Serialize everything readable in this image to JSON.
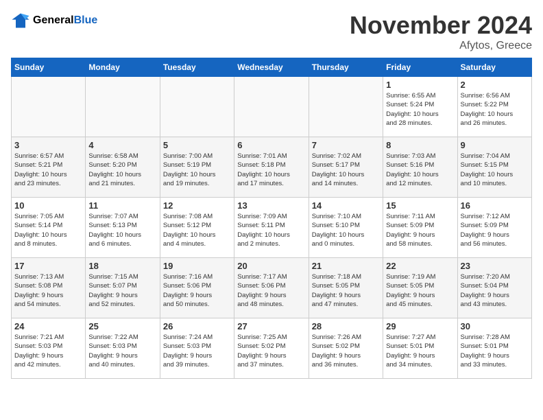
{
  "header": {
    "logo_line1": "General",
    "logo_line2": "Blue",
    "month": "November 2024",
    "location": "Afytos, Greece"
  },
  "weekdays": [
    "Sunday",
    "Monday",
    "Tuesday",
    "Wednesday",
    "Thursday",
    "Friday",
    "Saturday"
  ],
  "weeks": [
    [
      {
        "day": "",
        "info": ""
      },
      {
        "day": "",
        "info": ""
      },
      {
        "day": "",
        "info": ""
      },
      {
        "day": "",
        "info": ""
      },
      {
        "day": "",
        "info": ""
      },
      {
        "day": "1",
        "info": "Sunrise: 6:55 AM\nSunset: 5:24 PM\nDaylight: 10 hours\nand 28 minutes."
      },
      {
        "day": "2",
        "info": "Sunrise: 6:56 AM\nSunset: 5:22 PM\nDaylight: 10 hours\nand 26 minutes."
      }
    ],
    [
      {
        "day": "3",
        "info": "Sunrise: 6:57 AM\nSunset: 5:21 PM\nDaylight: 10 hours\nand 23 minutes."
      },
      {
        "day": "4",
        "info": "Sunrise: 6:58 AM\nSunset: 5:20 PM\nDaylight: 10 hours\nand 21 minutes."
      },
      {
        "day": "5",
        "info": "Sunrise: 7:00 AM\nSunset: 5:19 PM\nDaylight: 10 hours\nand 19 minutes."
      },
      {
        "day": "6",
        "info": "Sunrise: 7:01 AM\nSunset: 5:18 PM\nDaylight: 10 hours\nand 17 minutes."
      },
      {
        "day": "7",
        "info": "Sunrise: 7:02 AM\nSunset: 5:17 PM\nDaylight: 10 hours\nand 14 minutes."
      },
      {
        "day": "8",
        "info": "Sunrise: 7:03 AM\nSunset: 5:16 PM\nDaylight: 10 hours\nand 12 minutes."
      },
      {
        "day": "9",
        "info": "Sunrise: 7:04 AM\nSunset: 5:15 PM\nDaylight: 10 hours\nand 10 minutes."
      }
    ],
    [
      {
        "day": "10",
        "info": "Sunrise: 7:05 AM\nSunset: 5:14 PM\nDaylight: 10 hours\nand 8 minutes."
      },
      {
        "day": "11",
        "info": "Sunrise: 7:07 AM\nSunset: 5:13 PM\nDaylight: 10 hours\nand 6 minutes."
      },
      {
        "day": "12",
        "info": "Sunrise: 7:08 AM\nSunset: 5:12 PM\nDaylight: 10 hours\nand 4 minutes."
      },
      {
        "day": "13",
        "info": "Sunrise: 7:09 AM\nSunset: 5:11 PM\nDaylight: 10 hours\nand 2 minutes."
      },
      {
        "day": "14",
        "info": "Sunrise: 7:10 AM\nSunset: 5:10 PM\nDaylight: 10 hours\nand 0 minutes."
      },
      {
        "day": "15",
        "info": "Sunrise: 7:11 AM\nSunset: 5:09 PM\nDaylight: 9 hours\nand 58 minutes."
      },
      {
        "day": "16",
        "info": "Sunrise: 7:12 AM\nSunset: 5:09 PM\nDaylight: 9 hours\nand 56 minutes."
      }
    ],
    [
      {
        "day": "17",
        "info": "Sunrise: 7:13 AM\nSunset: 5:08 PM\nDaylight: 9 hours\nand 54 minutes."
      },
      {
        "day": "18",
        "info": "Sunrise: 7:15 AM\nSunset: 5:07 PM\nDaylight: 9 hours\nand 52 minutes."
      },
      {
        "day": "19",
        "info": "Sunrise: 7:16 AM\nSunset: 5:06 PM\nDaylight: 9 hours\nand 50 minutes."
      },
      {
        "day": "20",
        "info": "Sunrise: 7:17 AM\nSunset: 5:06 PM\nDaylight: 9 hours\nand 48 minutes."
      },
      {
        "day": "21",
        "info": "Sunrise: 7:18 AM\nSunset: 5:05 PM\nDaylight: 9 hours\nand 47 minutes."
      },
      {
        "day": "22",
        "info": "Sunrise: 7:19 AM\nSunset: 5:05 PM\nDaylight: 9 hours\nand 45 minutes."
      },
      {
        "day": "23",
        "info": "Sunrise: 7:20 AM\nSunset: 5:04 PM\nDaylight: 9 hours\nand 43 minutes."
      }
    ],
    [
      {
        "day": "24",
        "info": "Sunrise: 7:21 AM\nSunset: 5:03 PM\nDaylight: 9 hours\nand 42 minutes."
      },
      {
        "day": "25",
        "info": "Sunrise: 7:22 AM\nSunset: 5:03 PM\nDaylight: 9 hours\nand 40 minutes."
      },
      {
        "day": "26",
        "info": "Sunrise: 7:24 AM\nSunset: 5:03 PM\nDaylight: 9 hours\nand 39 minutes."
      },
      {
        "day": "27",
        "info": "Sunrise: 7:25 AM\nSunset: 5:02 PM\nDaylight: 9 hours\nand 37 minutes."
      },
      {
        "day": "28",
        "info": "Sunrise: 7:26 AM\nSunset: 5:02 PM\nDaylight: 9 hours\nand 36 minutes."
      },
      {
        "day": "29",
        "info": "Sunrise: 7:27 AM\nSunset: 5:01 PM\nDaylight: 9 hours\nand 34 minutes."
      },
      {
        "day": "30",
        "info": "Sunrise: 7:28 AM\nSunset: 5:01 PM\nDaylight: 9 hours\nand 33 minutes."
      }
    ]
  ]
}
